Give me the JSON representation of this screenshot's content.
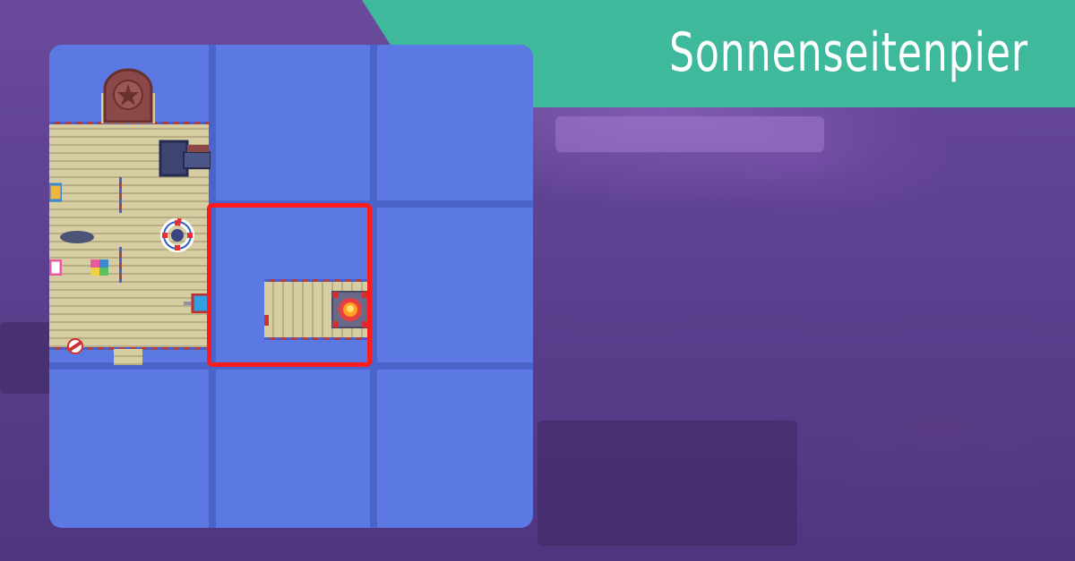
{
  "title": "Sonnenseitenpier",
  "colors": {
    "banner": "#3fb99c",
    "water": "#5b78e3",
    "grid": "#4a64c9",
    "selection": "#ff1b1b",
    "background": "#5a3f8a"
  },
  "map": {
    "rows": 3,
    "cols": 3,
    "selected_cell": {
      "row": 2,
      "col": 2
    },
    "icons": [
      "star-sign-icon",
      "cannon-icon",
      "life-ring-icon",
      "gift-box-icon",
      "candy-icon",
      "fish-shadow-icon",
      "lantern-icon",
      "campfire-icon"
    ]
  }
}
